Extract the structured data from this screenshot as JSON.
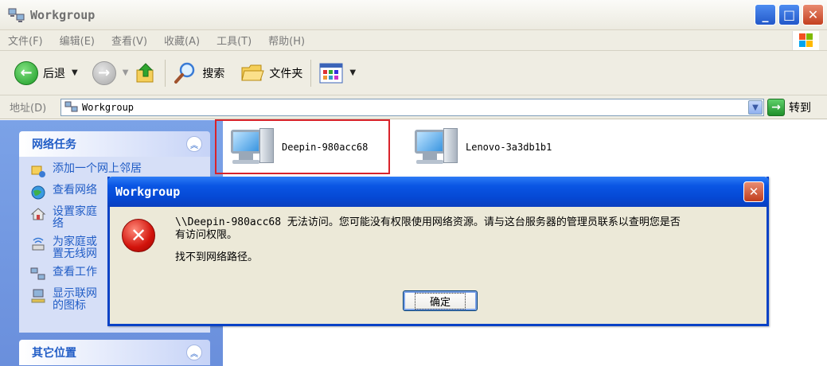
{
  "window": {
    "title": "Workgroup"
  },
  "menu": {
    "items": [
      "文件(F)",
      "编辑(E)",
      "查看(V)",
      "收藏(A)",
      "工具(T)",
      "帮助(H)"
    ]
  },
  "toolbar": {
    "back_label": "后退",
    "search_label": "搜索",
    "folders_label": "文件夹"
  },
  "address": {
    "label": "地址(D)",
    "value": "Workgroup",
    "go_label": "转到"
  },
  "network_tasks": {
    "title": "网络任务",
    "items": [
      "添加一个网上邻居",
      "查看网络",
      "设置家庭",
      "络",
      "为家庭或",
      "置无线网",
      "查看工作",
      "显示联网",
      "的图标"
    ]
  },
  "other_places": {
    "title": "其它位置"
  },
  "computers": [
    "Deepin-980acc68",
    "Lenovo-3a3db1b1"
  ],
  "dialog": {
    "title": "Workgroup",
    "message_line1": "\\\\Deepin-980acc68 无法访问。您可能没有权限使用网络资源。请与这台服务器的管理员联系以查明您是否",
    "message_line1b": "有访问权限。",
    "message_line2": "找不到网络路径。",
    "ok_label": "确定"
  },
  "colors": {
    "dialog_border": "#0a42c6",
    "task_link": "#215dc6",
    "highlight": "#d9232b"
  }
}
